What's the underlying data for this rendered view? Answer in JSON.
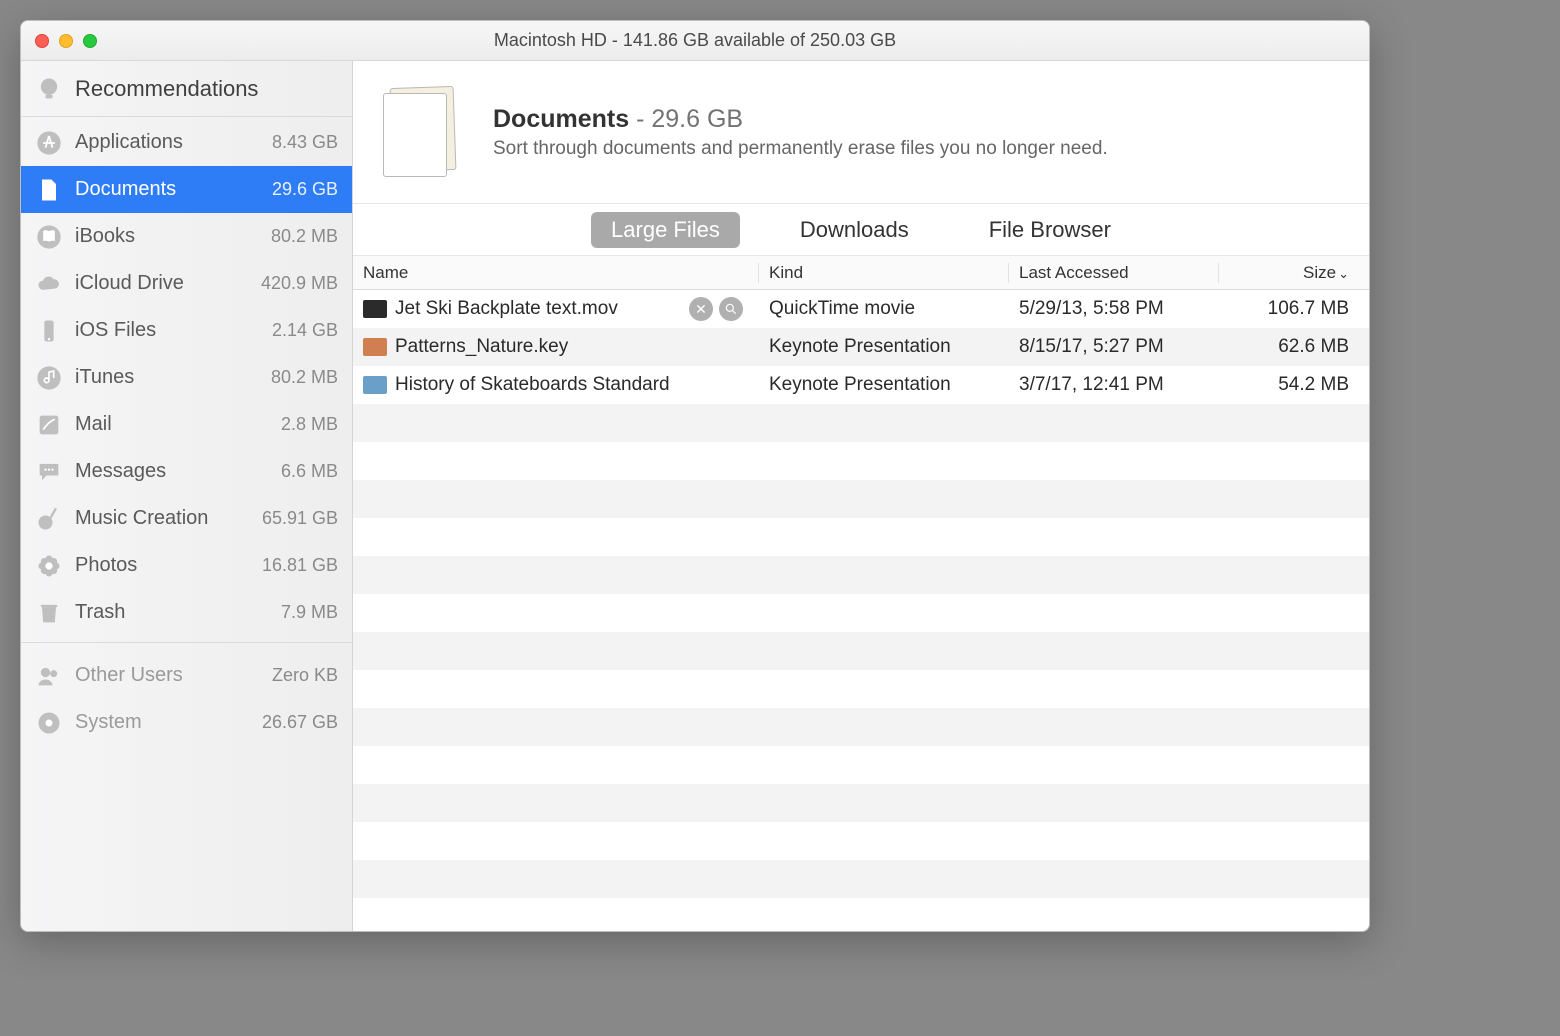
{
  "window": {
    "title": "Macintosh HD - 141.86 GB available of 250.03 GB"
  },
  "sidebar": {
    "recommendations": "Recommendations",
    "items": [
      {
        "label": "Applications",
        "size": "8.43 GB",
        "icon": "appstore"
      },
      {
        "label": "Documents",
        "size": "29.6 GB",
        "icon": "document",
        "active": true
      },
      {
        "label": "iBooks",
        "size": "80.2 MB",
        "icon": "book"
      },
      {
        "label": "iCloud Drive",
        "size": "420.9 MB",
        "icon": "cloud"
      },
      {
        "label": "iOS Files",
        "size": "2.14 GB",
        "icon": "iphone"
      },
      {
        "label": "iTunes",
        "size": "80.2 MB",
        "icon": "music-note"
      },
      {
        "label": "Mail",
        "size": "2.8 MB",
        "icon": "stamp"
      },
      {
        "label": "Messages",
        "size": "6.6 MB",
        "icon": "bubble"
      },
      {
        "label": "Music Creation",
        "size": "65.91 GB",
        "icon": "guitar"
      },
      {
        "label": "Photos",
        "size": "16.81 GB",
        "icon": "flower"
      },
      {
        "label": "Trash",
        "size": "7.9 MB",
        "icon": "trash"
      }
    ],
    "footer": [
      {
        "label": "Other Users",
        "size": "Zero KB",
        "icon": "users"
      },
      {
        "label": "System",
        "size": "26.67 GB",
        "icon": "gear"
      }
    ]
  },
  "header": {
    "title": "Documents",
    "sep": " - ",
    "size": "29.6 GB",
    "subtitle": "Sort through documents and permanently erase files you no longer need."
  },
  "tabs": {
    "items": [
      "Large Files",
      "Downloads",
      "File Browser"
    ],
    "active_index": 0
  },
  "columns": {
    "name": "Name",
    "kind": "Kind",
    "date": "Last Accessed",
    "size": "Size"
  },
  "rows": [
    {
      "name": "Jet Ski Backplate text.mov",
      "kind": "QuickTime movie",
      "date": "5/29/13, 5:58 PM",
      "size": "106.7 MB",
      "thumb": "#2b2b2b"
    },
    {
      "name": "Patterns_Nature.key",
      "kind": "Keynote Presentation",
      "date": "8/15/17, 5:27 PM",
      "size": "62.6 MB",
      "thumb": "#d08050"
    },
    {
      "name": "History of Skateboards Standard",
      "kind": "Keynote Presentation",
      "date": "3/7/17, 12:41 PM",
      "size": "54.2 MB",
      "thumb": "#6aa0c8"
    }
  ]
}
